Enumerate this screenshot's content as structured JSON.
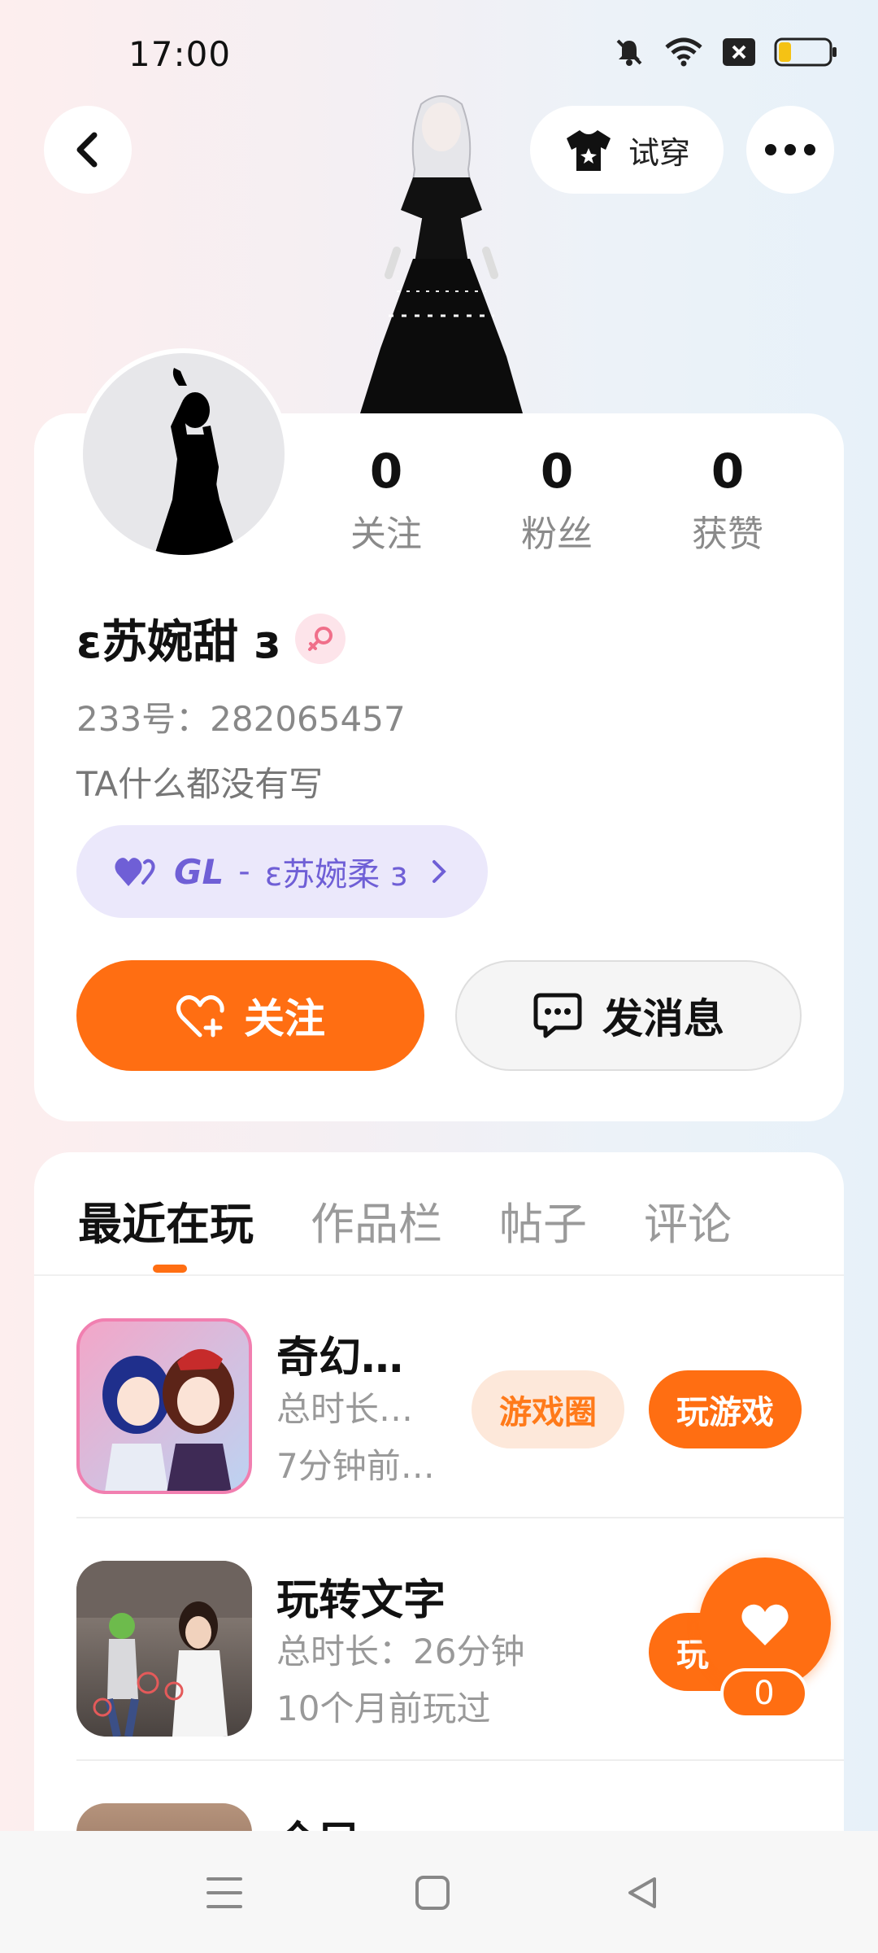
{
  "status_bar": {
    "time": "17:00",
    "battery_level": 0.25
  },
  "header": {
    "try_on_label": "试穿"
  },
  "stats": [
    {
      "value": "0",
      "label": "关注"
    },
    {
      "value": "0",
      "label": "粉丝"
    },
    {
      "value": "0",
      "label": "获赞"
    }
  ],
  "profile": {
    "name": "ε苏婉甜 з",
    "uid": "233号：282065457",
    "bio": "TA什么都没有写",
    "relation": {
      "type": "GL",
      "separator": "-",
      "partner": "ε苏婉柔 з"
    }
  },
  "actions": {
    "follow_label": "关注",
    "message_label": "发消息"
  },
  "tabs": [
    {
      "label": "最近在玩",
      "active": true
    },
    {
      "label": "作品栏",
      "active": false
    },
    {
      "label": "帖子",
      "active": false
    },
    {
      "label": "评论",
      "active": false
    }
  ],
  "games": [
    {
      "title": "奇幻…",
      "duration": "总时长…",
      "last_played": "7分钟前…",
      "circle_label": "游戏圈",
      "play_label": "玩游戏"
    },
    {
      "title": "玩转文字",
      "duration": "总时长：26分钟",
      "last_played": "10个月前玩过",
      "play_label": "玩"
    },
    {
      "title": "全民"
    }
  ],
  "like_fab": {
    "count": "0"
  },
  "colors": {
    "accent": "#ff6e12",
    "relation_purple": "#6f5fd6"
  }
}
